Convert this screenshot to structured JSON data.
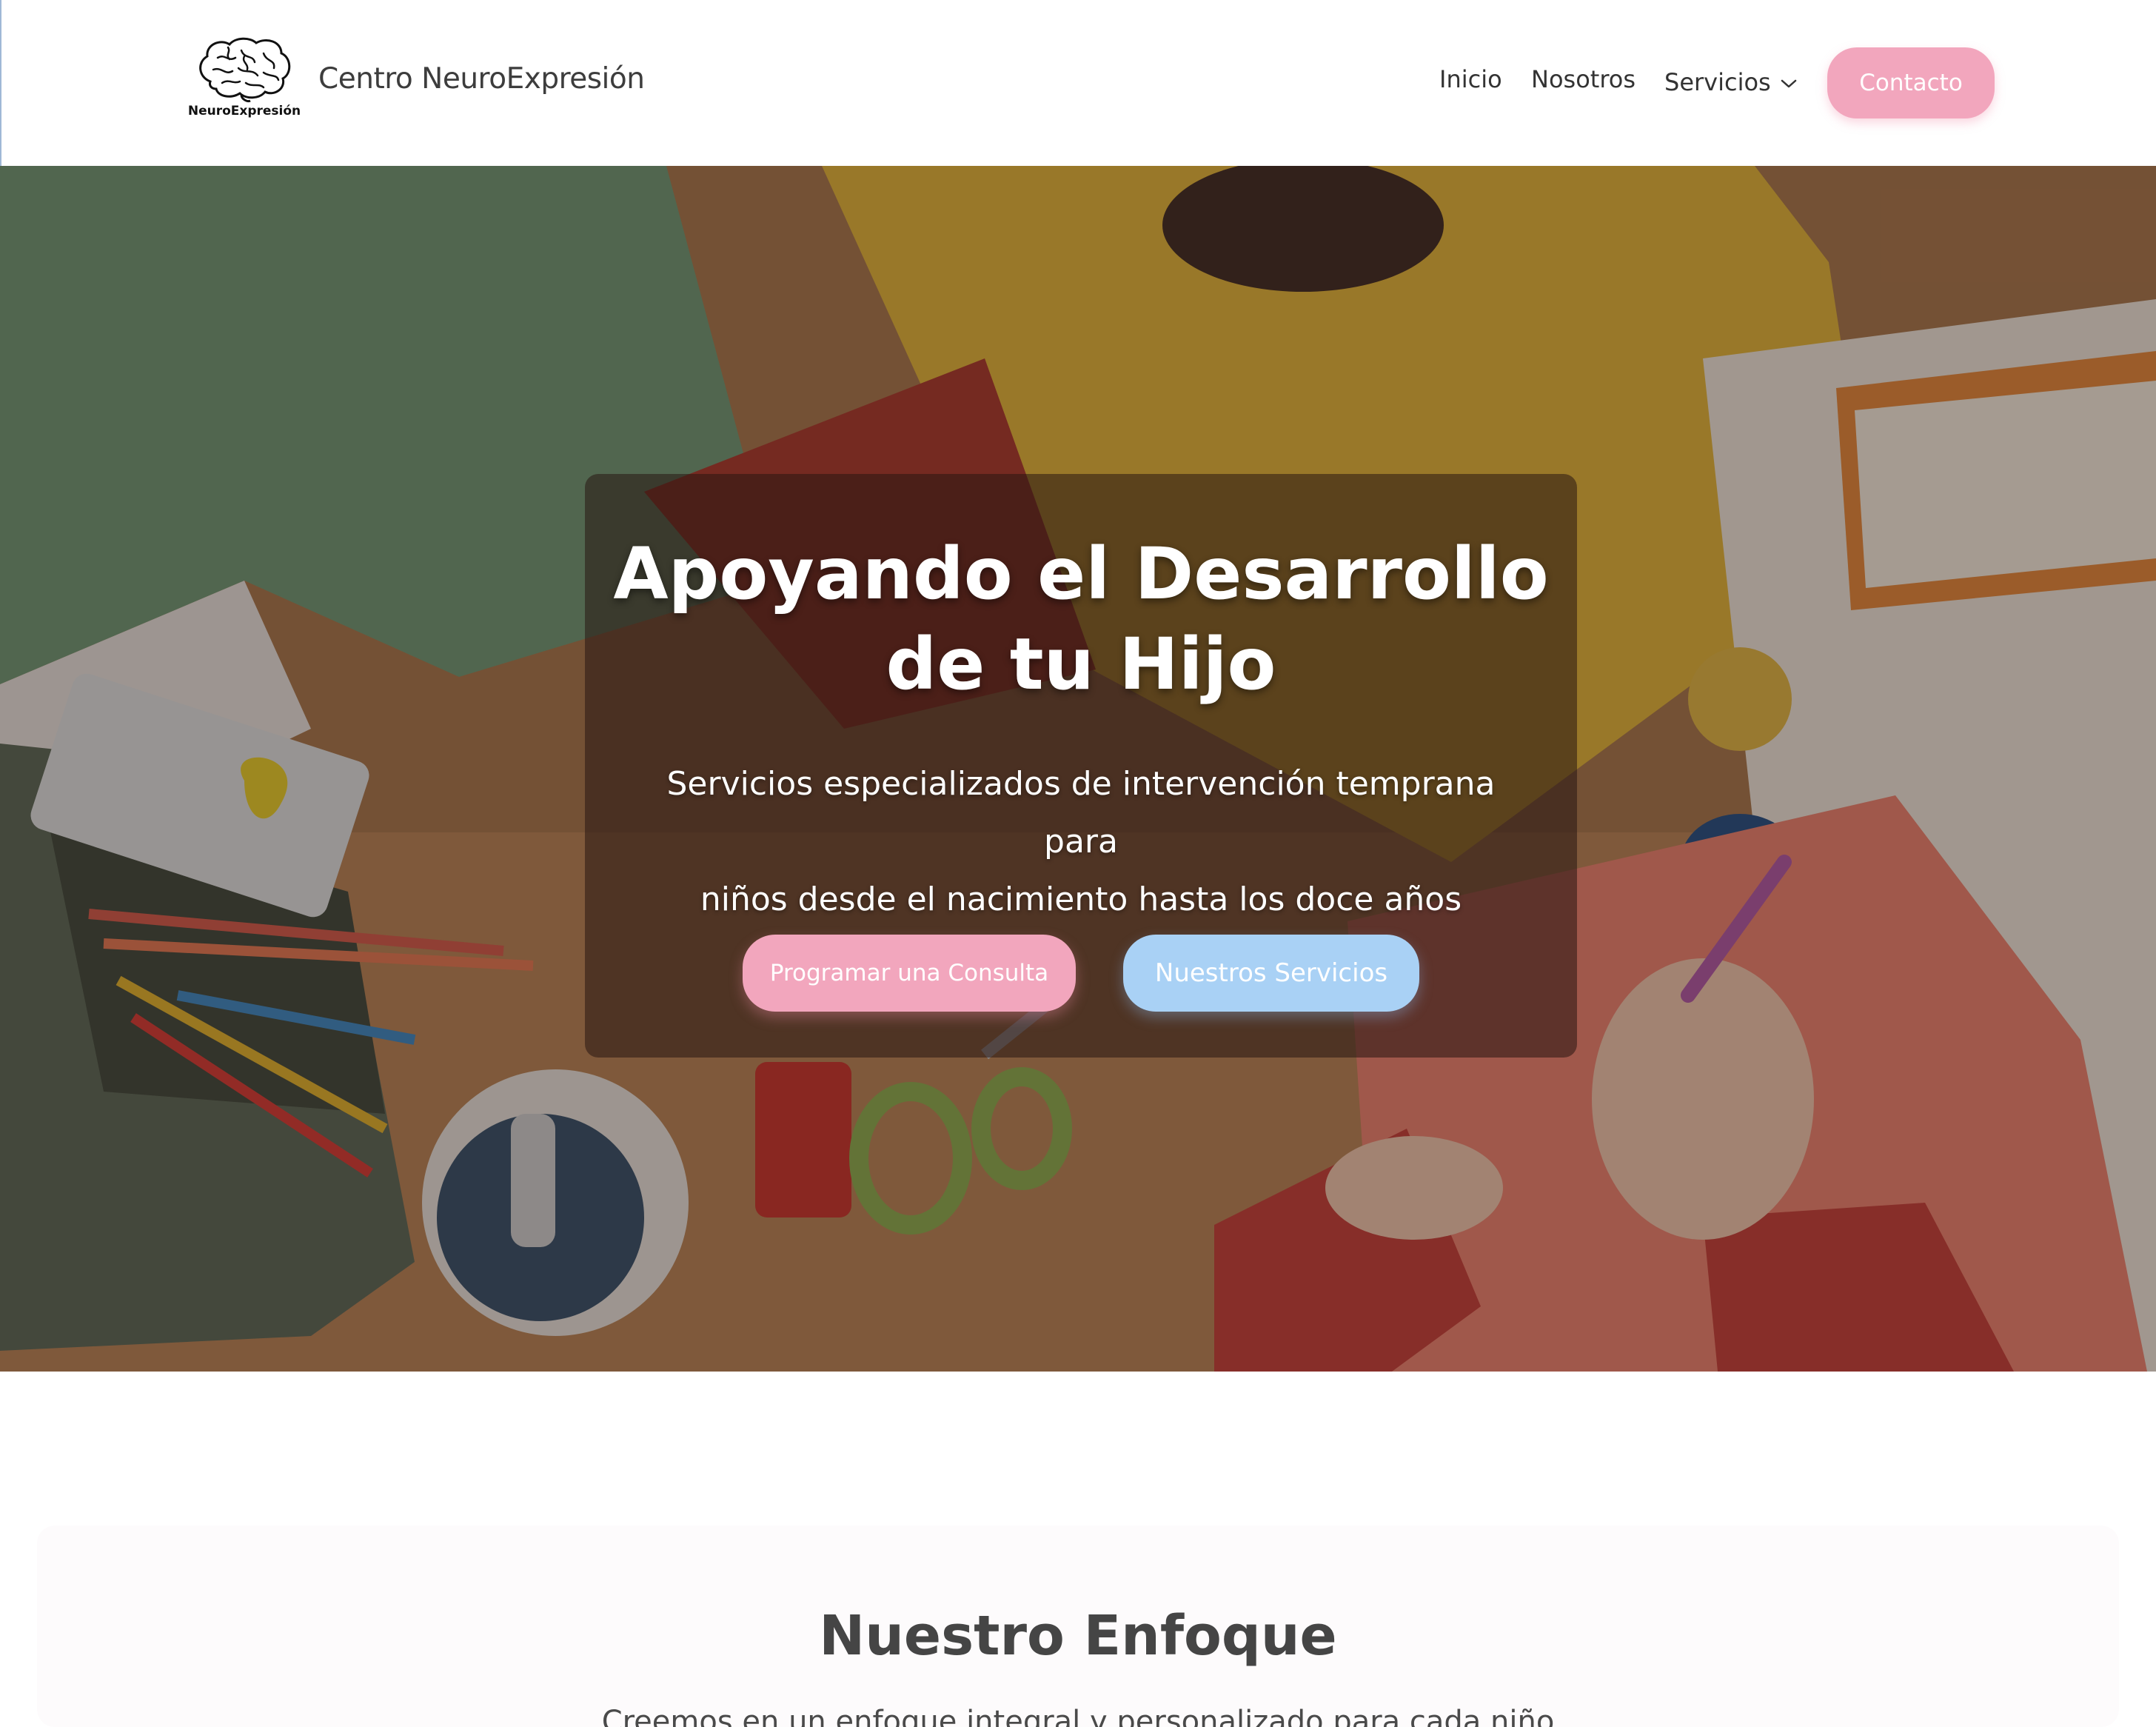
{
  "header": {
    "logo_caption": "NeuroExpresión",
    "site_title": "Centro NeuroExpresión",
    "nav": {
      "inicio": "Inicio",
      "nosotros": "Nosotros",
      "servicios": "Servicios",
      "contacto": "Contacto"
    }
  },
  "hero": {
    "title_line1": "Apoyando el Desarrollo",
    "title_line2": "de tu Hijo",
    "subtitle_line1": "Servicios especializados de intervención temprana para",
    "subtitle_line2": "niños desde el nacimiento hasta los doce años",
    "primary_button": "Programar una Consulta",
    "secondary_button": "Nuestros Servicios"
  },
  "approach": {
    "title": "Nuestro Enfoque",
    "text": "Creemos en un enfoque integral y personalizado para cada niño"
  },
  "colors": {
    "primary_pink": "#f2a6bd",
    "secondary_blue": "#a9d1f5"
  },
  "icons": {
    "logo": "brain-icon",
    "servicios_dropdown": "chevron-down-icon"
  }
}
